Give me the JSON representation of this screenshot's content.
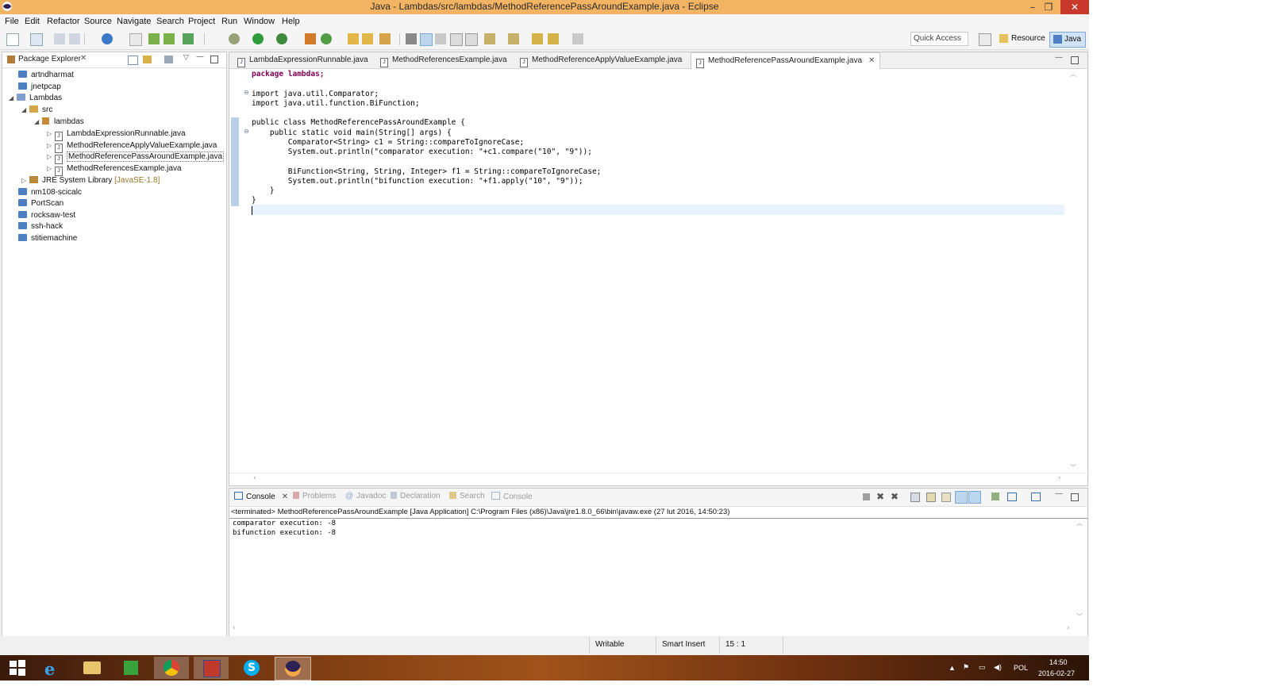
{
  "window": {
    "title": "Java - Lambdas/src/lambdas/MethodReferencePassAroundExample.java - Eclipse",
    "controls": [
      "–",
      "❐",
      "✕"
    ]
  },
  "menu": [
    "File",
    "Edit",
    "Refactor",
    "Source",
    "Navigate",
    "Search",
    "Project",
    "Run",
    "Window",
    "Help"
  ],
  "toolbar": {
    "quick_access": "Quick Access",
    "perspectives": [
      "Resource",
      "Java"
    ]
  },
  "package_explorer": {
    "title": "Package Explorer",
    "items": [
      {
        "label": "artndharmat",
        "level": 0,
        "kind": "project"
      },
      {
        "label": "jnetpcap",
        "level": 0,
        "kind": "project"
      },
      {
        "label": "Lambdas",
        "level": 0,
        "kind": "project",
        "expanded": true
      },
      {
        "label": "src",
        "level": 1,
        "kind": "srcfolder",
        "expanded": true
      },
      {
        "label": "lambdas",
        "level": 2,
        "kind": "package",
        "expanded": true
      },
      {
        "label": "LambdaExpressionRunnable.java",
        "level": 3,
        "kind": "java"
      },
      {
        "label": "MethodReferenceApplyValueExample.java",
        "level": 3,
        "kind": "java"
      },
      {
        "label": "MethodReferencePassAroundExample.java",
        "level": 3,
        "kind": "java",
        "selected": true
      },
      {
        "label": "MethodReferencesExample.java",
        "level": 3,
        "kind": "java"
      },
      {
        "label": "JRE System Library",
        "suffix": "[JavaSE-1.8]",
        "level": 1,
        "kind": "library"
      },
      {
        "label": "nm108-scicalc",
        "level": 0,
        "kind": "project"
      },
      {
        "label": "PortScan",
        "level": 0,
        "kind": "project"
      },
      {
        "label": "rocksaw-test",
        "level": 0,
        "kind": "project"
      },
      {
        "label": "ssh-hack",
        "level": 0,
        "kind": "project"
      },
      {
        "label": "stitiemachine",
        "level": 0,
        "kind": "project"
      }
    ]
  },
  "editor": {
    "tabs": [
      "LambdaExpressionRunnable.java",
      "MethodReferencesExample.java",
      "MethodReferenceApplyValueExample.java",
      "MethodReferencePassAroundExample.java"
    ],
    "active_tab": 3,
    "code": {
      "l1": "package lambdas;",
      "l3": "import java.util.Comparator;",
      "l4": "import java.util.function.BiFunction;",
      "l6": "public class MethodReferencePassAroundExample {",
      "l7": "    public static void main(String[] args) {",
      "l8": "        Comparator<String> c1 = String::compareToIgnoreCase;",
      "l9": "        System.out.println(\"comparator execution: \"+c1.compare(\"10\", \"9\"));",
      "l11": "        BiFunction<String, String, Integer> f1 = String::compareToIgnoreCase;",
      "l12": "        System.out.println(\"bifunction execution: \"+f1.apply(\"10\", \"9\"));",
      "l13": "    }",
      "l14": "}"
    }
  },
  "console": {
    "tabs": [
      "Console",
      "Problems",
      "Javadoc",
      "Declaration",
      "Search",
      "Console"
    ],
    "description": "<terminated> MethodReferencePassAroundExample [Java Application] C:\\Program Files (x86)\\Java\\jre1.8.0_66\\bin\\javaw.exe (27 lut 2016, 14:50:23)",
    "output": [
      "comparator execution: -8",
      "bifunction execution: -8"
    ]
  },
  "status": {
    "writable": "Writable",
    "insert_mode": "Smart Insert",
    "position": "15 : 1"
  },
  "taskbar": {
    "language": "POL",
    "time": "14:50",
    "date": "2016-02-27"
  }
}
